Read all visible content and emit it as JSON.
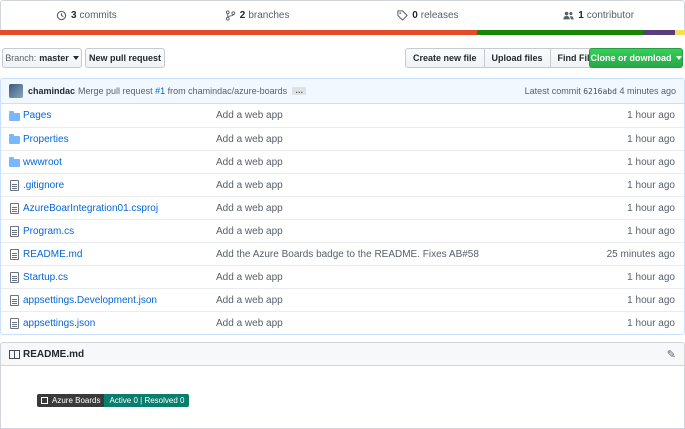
{
  "stats": {
    "commits": {
      "count": "3",
      "label": "commits"
    },
    "branches": {
      "count": "2",
      "label": "branches"
    },
    "releases": {
      "count": "0",
      "label": "releases"
    },
    "contributors": {
      "count": "1",
      "label": "contributor"
    }
  },
  "language_bar": [
    {
      "color": "#e34c26",
      "fraction": 0.697
    },
    {
      "color": "#178600",
      "fraction": 0.242
    },
    {
      "color": "#563d7c",
      "fraction": 0.047
    },
    {
      "color": "#f1e05a",
      "fraction": 0.014
    }
  ],
  "toolbar": {
    "branch_label": "Branch:",
    "branch_value": "master",
    "new_pr": "New pull request",
    "create_file": "Create new file",
    "upload_files": "Upload files",
    "find_file": "Find File",
    "clone": "Clone or download"
  },
  "commit": {
    "author": "chamindac",
    "message_prefix": "Merge pull request",
    "pr_link": "#1",
    "message_suffix": "from chamindac/azure-boards",
    "ellipsis": "…",
    "latest_label": "Latest commit",
    "sha": "6216abd",
    "age": "4 minutes ago"
  },
  "files": [
    {
      "type": "dir",
      "icon": "folder-icon",
      "name": "Pages",
      "message": "Add a web app",
      "age": "1 hour ago"
    },
    {
      "type": "dir",
      "icon": "folder-icon",
      "name": "Properties",
      "message": "Add a web app",
      "age": "1 hour ago"
    },
    {
      "type": "dir",
      "icon": "folder-icon",
      "name": "wwwroot",
      "message": "Add a web app",
      "age": "1 hour ago"
    },
    {
      "type": "file",
      "icon": "file-icon",
      "name": ".gitignore",
      "message": "Add a web app",
      "age": "1 hour ago"
    },
    {
      "type": "file",
      "icon": "file-icon",
      "name": "AzureBoarIntegration01.csproj",
      "message": "Add a web app",
      "age": "1 hour ago"
    },
    {
      "type": "file",
      "icon": "file-icon",
      "name": "Program.cs",
      "message": "Add a web app",
      "age": "1 hour ago"
    },
    {
      "type": "file",
      "icon": "file-icon",
      "name": "README.md",
      "message": "Add the Azure Boards badge to the README. Fixes AB#58",
      "age": "25 minutes ago"
    },
    {
      "type": "file",
      "icon": "file-icon",
      "name": "Startup.cs",
      "message": "Add a web app",
      "age": "1 hour ago"
    },
    {
      "type": "file",
      "icon": "file-icon",
      "name": "appsettings.Development.json",
      "message": "Add a web app",
      "age": "1 hour ago"
    },
    {
      "type": "file",
      "icon": "file-icon",
      "name": "appsettings.json",
      "message": "Add a web app",
      "age": "1 hour ago"
    }
  ],
  "readme": {
    "title": "README.md",
    "badge_left": "Azure Boards",
    "badge_right": "Active 0 | Resolved 0"
  }
}
